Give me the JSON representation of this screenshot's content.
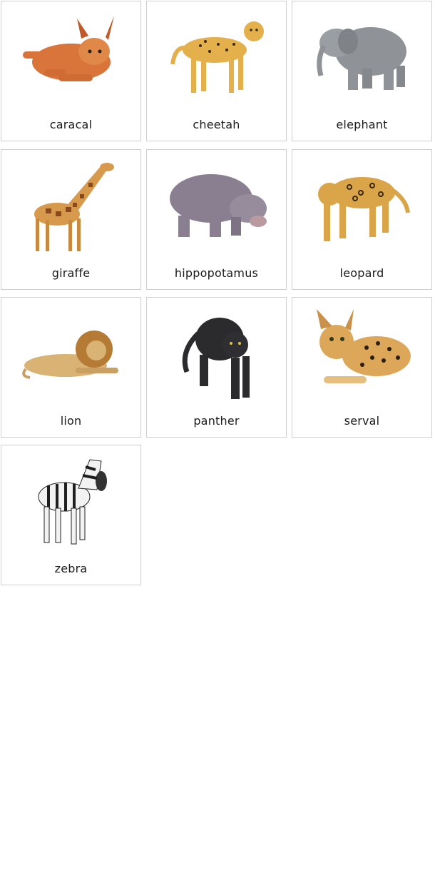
{
  "cards": [
    {
      "label": "caracal",
      "icon": "caracal-illustration"
    },
    {
      "label": "cheetah",
      "icon": "cheetah-illustration"
    },
    {
      "label": "elephant",
      "icon": "elephant-illustration"
    },
    {
      "label": "giraffe",
      "icon": "giraffe-illustration"
    },
    {
      "label": "hippopotamus",
      "icon": "hippopotamus-illustration"
    },
    {
      "label": "leopard",
      "icon": "leopard-illustration"
    },
    {
      "label": "lion",
      "icon": "lion-illustration"
    },
    {
      "label": "panther",
      "icon": "panther-illustration"
    },
    {
      "label": "serval",
      "icon": "serval-illustration"
    },
    {
      "label": "zebra",
      "icon": "zebra-illustration"
    }
  ]
}
